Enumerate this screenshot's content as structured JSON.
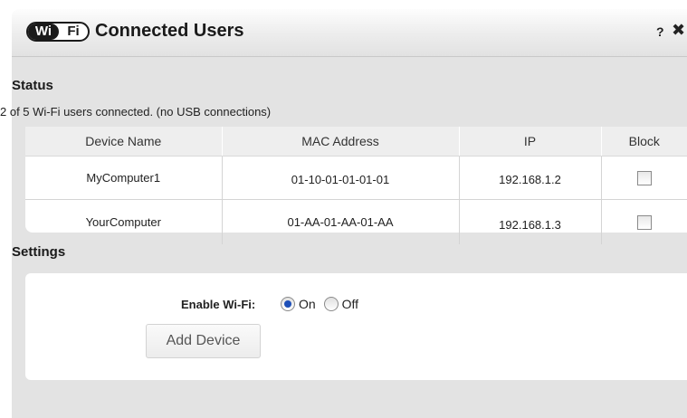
{
  "header": {
    "logo_wi": "Wi",
    "logo_fi": "Fi",
    "title": "Connected Users",
    "help": "?",
    "close": "✖"
  },
  "status": {
    "heading": "Status",
    "summary": "2 of 5 Wi-Fi users connected. (no USB connections)",
    "columns": [
      "Device Name",
      "MAC Address",
      "IP",
      "Block"
    ],
    "rows": [
      {
        "device": "MyComputer1",
        "mac": "01-10-01-01-01-01",
        "ip": "192.168.1.2",
        "blocked": false
      },
      {
        "device": "YourComputer",
        "mac": "01-AA-01-AA-01-AA",
        "ip": "192.168.1.3",
        "blocked": false
      }
    ]
  },
  "settings": {
    "heading": "Settings",
    "enable_wifi_label": "Enable Wi-Fi:",
    "options": [
      {
        "label": "On",
        "selected": true
      },
      {
        "label": "Off",
        "selected": false
      }
    ],
    "add_device_label": "Add Device"
  }
}
